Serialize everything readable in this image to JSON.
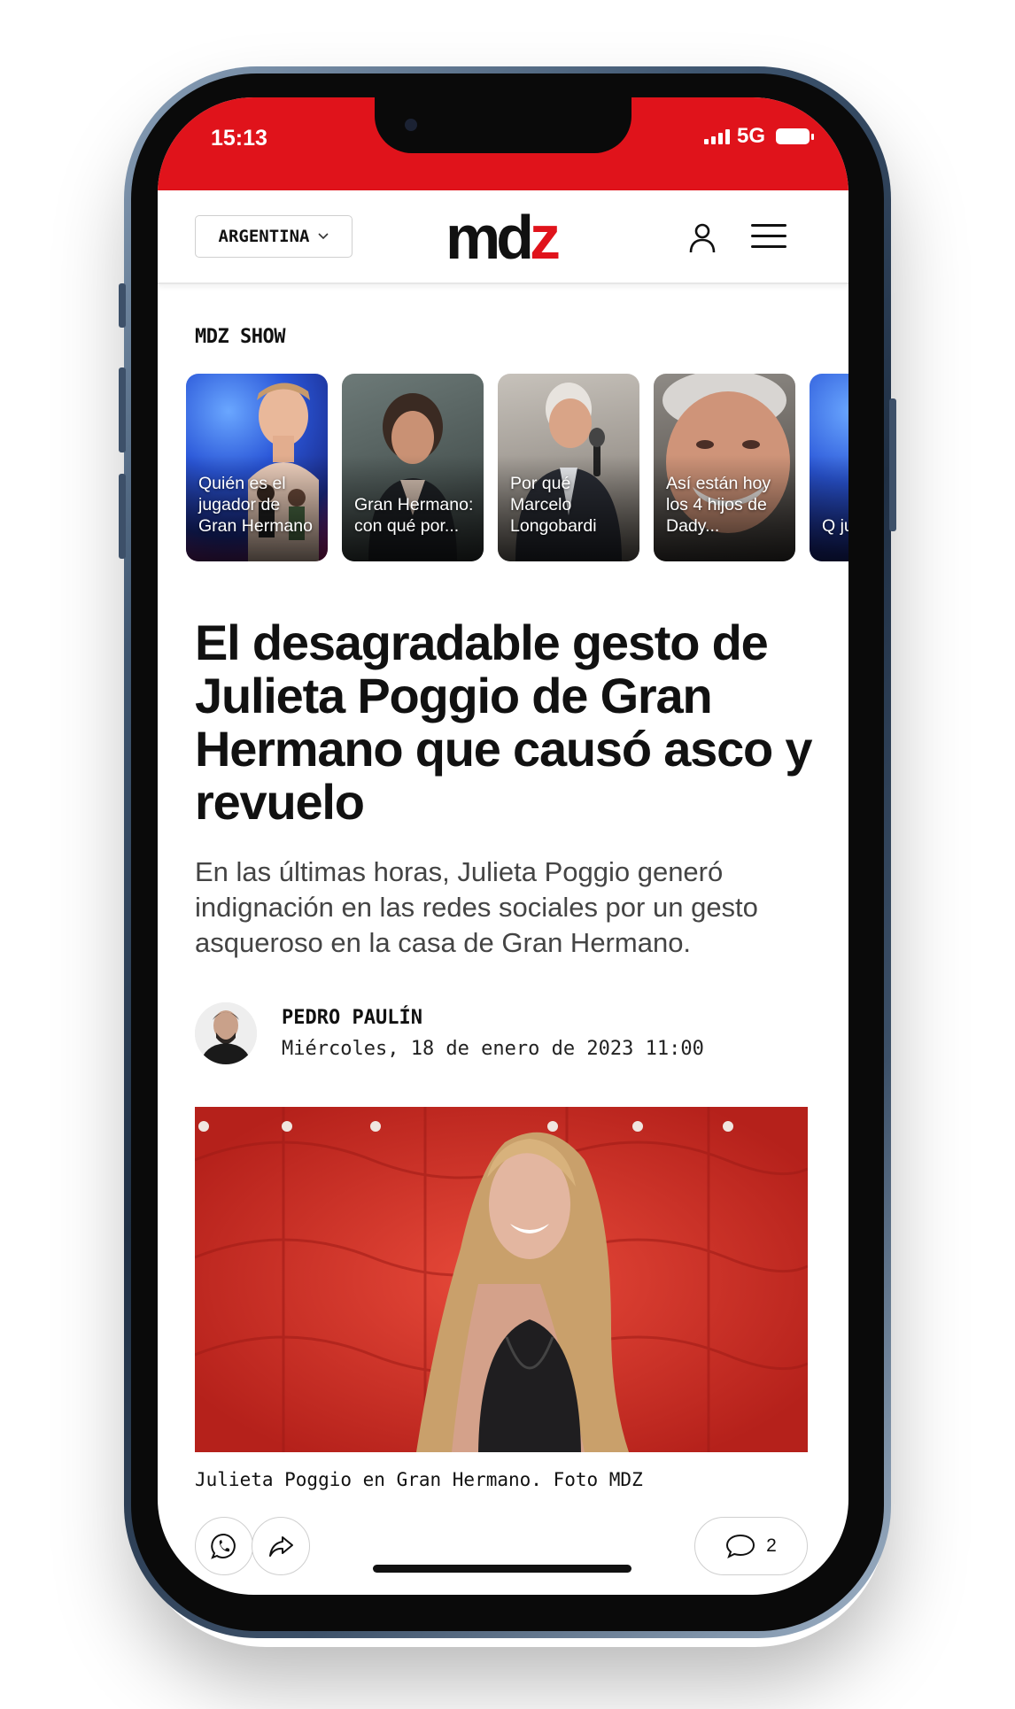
{
  "status_bar": {
    "time": "15:13",
    "network": "5G"
  },
  "header": {
    "country_selector": "ARGENTINA",
    "logo_main": "md",
    "logo_accent": "z",
    "colors": {
      "brand_red": "#e0131b"
    }
  },
  "section": {
    "title": "MDZ SHOW"
  },
  "stories": [
    {
      "label": "Quién es el jugador de Gran Hermano"
    },
    {
      "label": "Gran Hermano: con qué por..."
    },
    {
      "label": "Por qué Marcelo Longobardi"
    },
    {
      "label": "Así están hoy los 4 hijos de Dady..."
    },
    {
      "label": "Q ju G H"
    }
  ],
  "article": {
    "headline": "El desagradable gesto de Julieta Poggio de Gran Hermano que causó asco y revuelo",
    "lead": "En las últimas horas, Julieta Poggio generó indignación en las redes sociales por un gesto asqueroso en la casa de Gran Hermano.",
    "author": "PEDRO PAULÍN",
    "date": "Miércoles, 18 de enero de 2023 11:00",
    "image_caption": "Julieta Poggio en Gran Hermano. Foto MDZ"
  },
  "actions": {
    "whatsapp_icon": "whatsapp-icon",
    "share_icon": "share-icon",
    "comment_icon": "comment-icon",
    "comment_count": "2"
  }
}
